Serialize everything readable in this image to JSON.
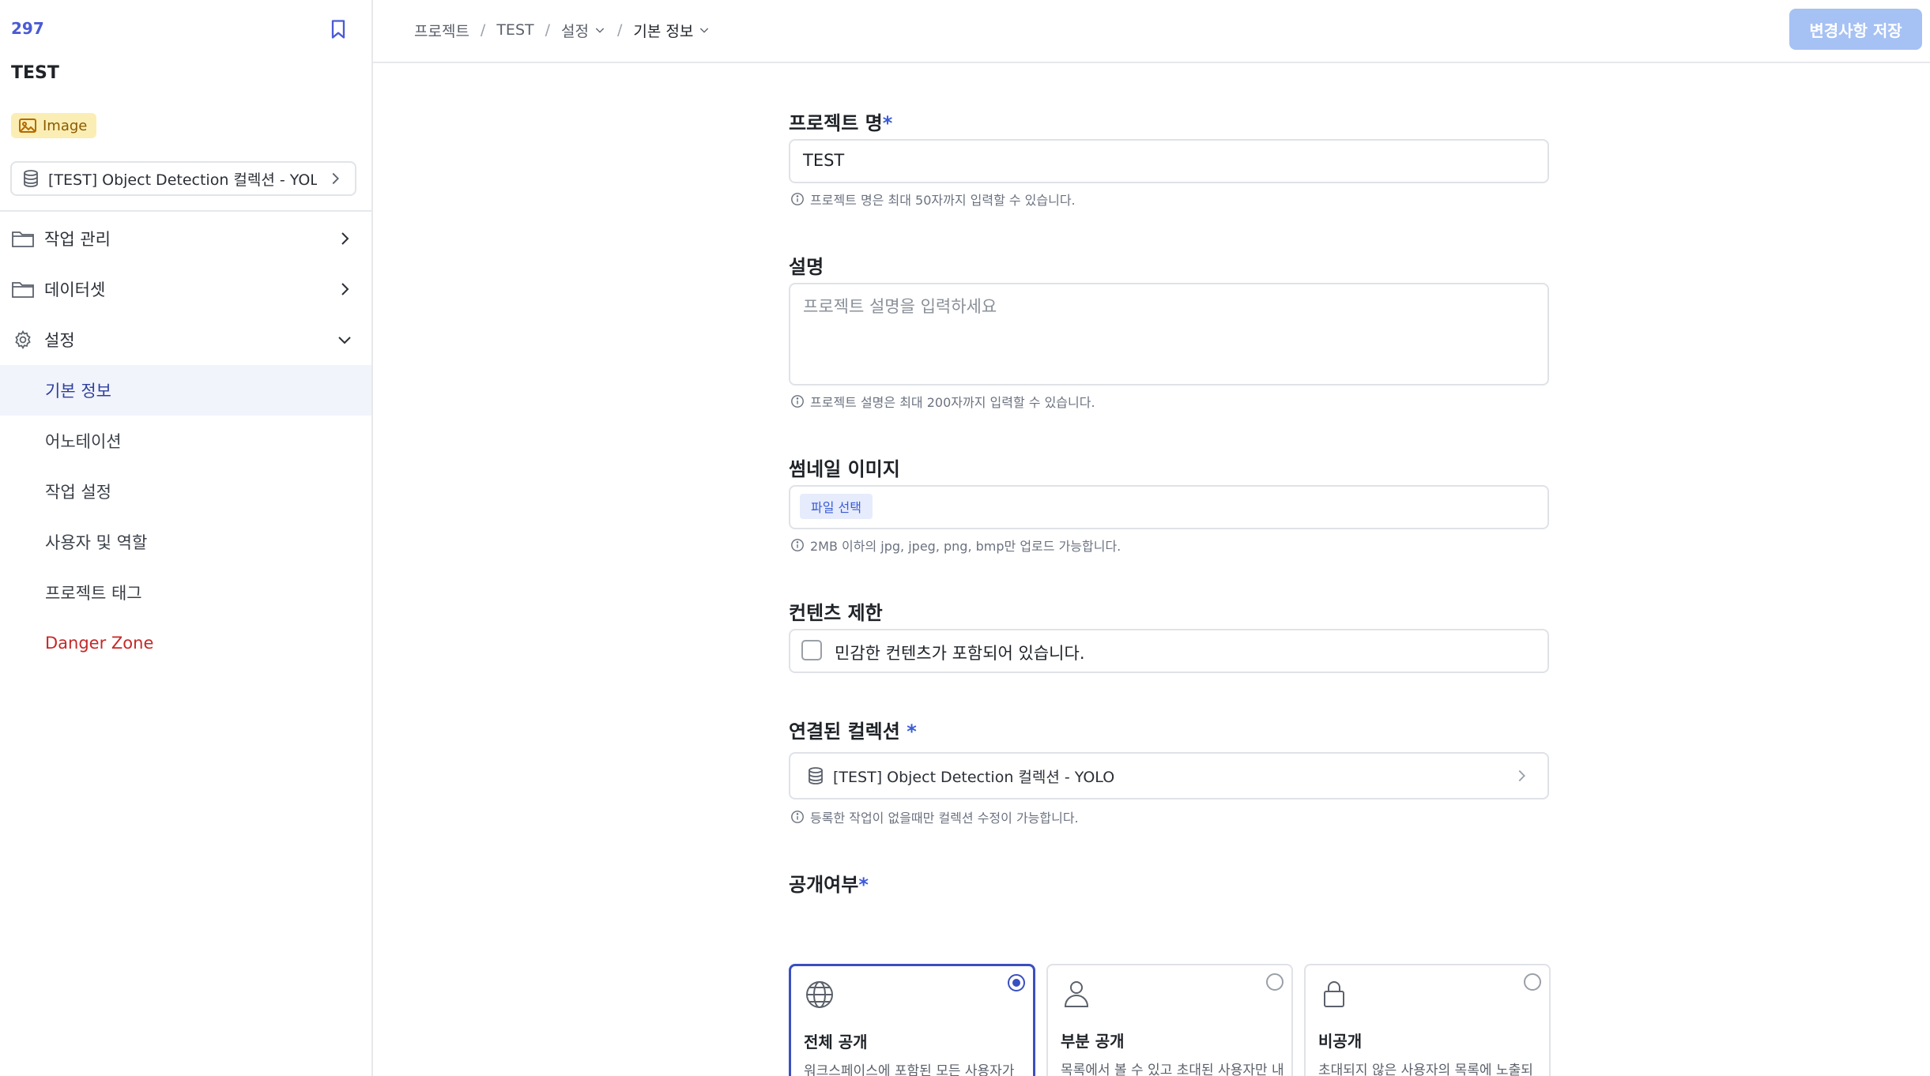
{
  "sidebar": {
    "project_id": "297",
    "project_name": "TEST",
    "type_badge": "Image",
    "collection": "[TEST] Object Detection 컬렉션 - YOLO",
    "nav": [
      {
        "label": "작업 관리",
        "icon": "folder-icon",
        "state": "collapsed"
      },
      {
        "label": "데이터셋",
        "icon": "folder-icon",
        "state": "collapsed"
      },
      {
        "label": "설정",
        "icon": "gear-icon",
        "state": "expanded"
      }
    ],
    "settings_items": [
      {
        "label": "기본 정보",
        "active": true
      },
      {
        "label": "어노테이션",
        "active": false
      },
      {
        "label": "작업 설정",
        "active": false
      },
      {
        "label": "사용자 및 역할",
        "active": false
      },
      {
        "label": "프로젝트 태그",
        "active": false
      },
      {
        "label": "Danger Zone",
        "active": false,
        "danger": true
      }
    ]
  },
  "header": {
    "breadcrumbs": [
      "프로젝트",
      "TEST",
      "설정",
      "기본 정보"
    ],
    "save_label": "변경사항 저장"
  },
  "form": {
    "name": {
      "label": "프로젝트 명",
      "required_mark": "*",
      "value": "TEST",
      "hint": "프로젝트 명은 최대 50자까지 입력할 수 있습니다."
    },
    "description": {
      "label": "설명",
      "placeholder": "프로젝트 설명을 입력하세요",
      "hint": "프로젝트 설명은 최대 200자까지 입력할 수 있습니다."
    },
    "thumbnail": {
      "label": "썸네일 이미지",
      "button": "파일 선택",
      "hint": "2MB 이하의 jpg, jpeg, png, bmp만 업로드 가능합니다."
    },
    "content_restriction": {
      "label": "컨텐츠 제한",
      "checkbox_label": "민감한 컨텐츠가 포함되어 있습니다.",
      "checked": false
    },
    "linked_collection": {
      "label": "연결된 컬렉션",
      "required_mark": "*",
      "value": "[TEST] Object Detection 컬렉션 - YOLO",
      "hint": "등록한 작업이 없을때만 컬렉션 수정이 가능합니다."
    },
    "visibility": {
      "label": "공개여부",
      "required_mark": "*",
      "options": [
        {
          "title": "전체 공개",
          "desc": "워크스페이스에 포함된 모든 사용자가 내용을 볼 수 있습니다.",
          "icon": "globe-icon",
          "selected": true
        },
        {
          "title": "부분 공개",
          "desc": "목록에서 볼 수 있고 초대된 사용자만 내용을 볼 수 있습니다.",
          "icon": "user-icon",
          "selected": false
        },
        {
          "title": "비공개",
          "desc": "초대되지 않은 사용자의 목록에 노출되지 않습니다.",
          "icon": "lock-icon",
          "selected": false
        }
      ]
    }
  },
  "colors": {
    "accent": "#3a4fc0",
    "save_button": "#a6c1f3",
    "badge_bg": "#fbeeb5",
    "danger": "#c62828",
    "active_nav_bg": "#f1f4fb"
  }
}
